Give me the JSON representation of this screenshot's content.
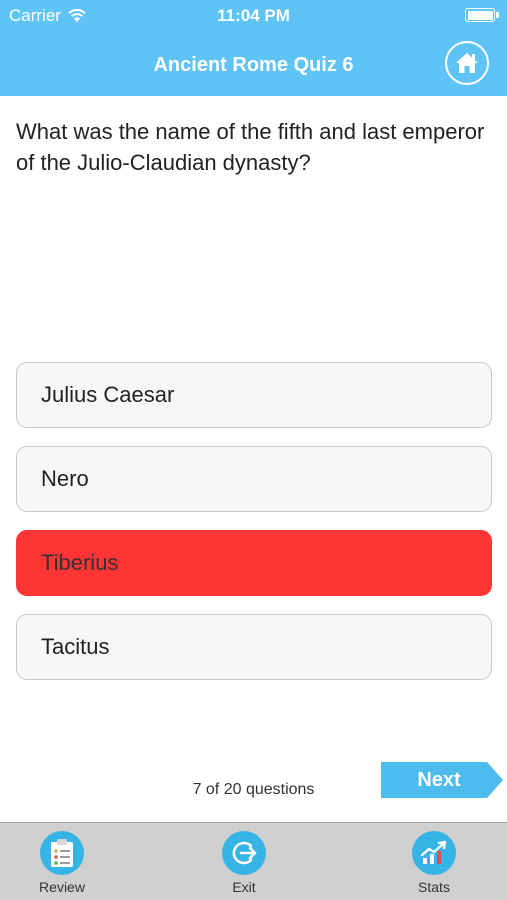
{
  "status_bar": {
    "carrier": "Carrier",
    "time": "11:04 PM"
  },
  "header": {
    "title": "Ancient Rome Quiz 6"
  },
  "question": {
    "text": "What was the name of the fifth and last emperor of the Julio-Claudian dynasty?"
  },
  "answers": [
    {
      "label": "Julius Caesar",
      "state": "default"
    },
    {
      "label": "Nero",
      "state": "default"
    },
    {
      "label": "Tiberius",
      "state": "selected-wrong"
    },
    {
      "label": "Tacitus",
      "state": "default"
    }
  ],
  "footer": {
    "progress": "7 of 20 questions",
    "next_label": "Next"
  },
  "tabbar": {
    "review_label": "Review",
    "exit_label": "Exit",
    "stats_label": "Stats"
  },
  "colors": {
    "header": "#5fc3f5",
    "wrong_answer": "#ff3535",
    "next_button": "#4dbbee",
    "tab_icon": "#37b4e6",
    "tabbar": "#d0d0d0"
  }
}
